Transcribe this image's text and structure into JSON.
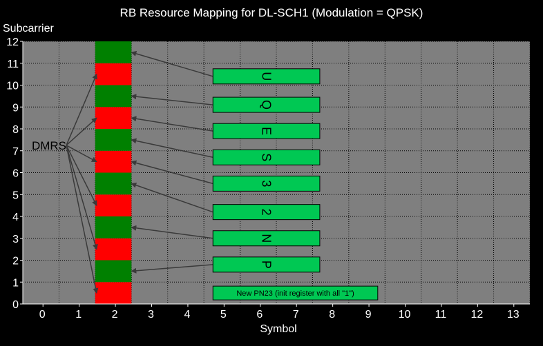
{
  "chart_data": {
    "type": "heatmap",
    "title": "RB Resource Mapping for DL-SCH1 (Modulation = QPSK)",
    "xlabel": "Symbol",
    "ylabel": "Subcarrier",
    "xlim": [
      -0.5,
      13.5
    ],
    "ylim": [
      0,
      12
    ],
    "x_ticks": [
      "0",
      "1",
      "2",
      "3",
      "4",
      "5",
      "6",
      "7",
      "8",
      "9",
      "10",
      "11",
      "12",
      "13"
    ],
    "y_ticks": [
      "0",
      "1",
      "2",
      "3",
      "4",
      "5",
      "6",
      "7",
      "8",
      "9",
      "10",
      "11",
      "12"
    ],
    "grid": true,
    "column_symbol": 2,
    "cells": [
      {
        "subcarrier": 0,
        "color": "red"
      },
      {
        "subcarrier": 1,
        "color": "green"
      },
      {
        "subcarrier": 2,
        "color": "red"
      },
      {
        "subcarrier": 3,
        "color": "green"
      },
      {
        "subcarrier": 4,
        "color": "red"
      },
      {
        "subcarrier": 5,
        "color": "green"
      },
      {
        "subcarrier": 6,
        "color": "red"
      },
      {
        "subcarrier": 7,
        "color": "green"
      },
      {
        "subcarrier": 8,
        "color": "red"
      },
      {
        "subcarrier": 9,
        "color": "green"
      },
      {
        "subcarrier": 10,
        "color": "red"
      },
      {
        "subcarrier": 11,
        "color": "green"
      }
    ],
    "dmrs_label": "DMRS",
    "dmrs_targets": [
      0,
      2,
      4,
      6,
      8,
      10
    ],
    "sequence_boxes": [
      {
        "label": "U",
        "row": 10.4,
        "target": 11.5
      },
      {
        "label": "Q",
        "row": 9.1,
        "target": 9.5
      },
      {
        "label": "E",
        "row": 7.9,
        "target": 8.5
      },
      {
        "label": "S",
        "row": 6.7,
        "target": 7.5
      },
      {
        "label": "3",
        "row": 5.5,
        "target": 6.5
      },
      {
        "label": "2",
        "row": 4.2,
        "target": 5.5
      },
      {
        "label": "N",
        "row": 3.0,
        "target": 3.5
      },
      {
        "label": "P",
        "row": 1.8,
        "target": 1.5
      }
    ],
    "note_box": {
      "label": "New PN23 (init register with all \"1\")",
      "row": 0.5
    },
    "colors": {
      "background": "#000000",
      "plot_area": "#7f7f7f",
      "grid": "#000000",
      "green": "#008000",
      "red": "#ff0000",
      "box": "#00c853"
    }
  }
}
